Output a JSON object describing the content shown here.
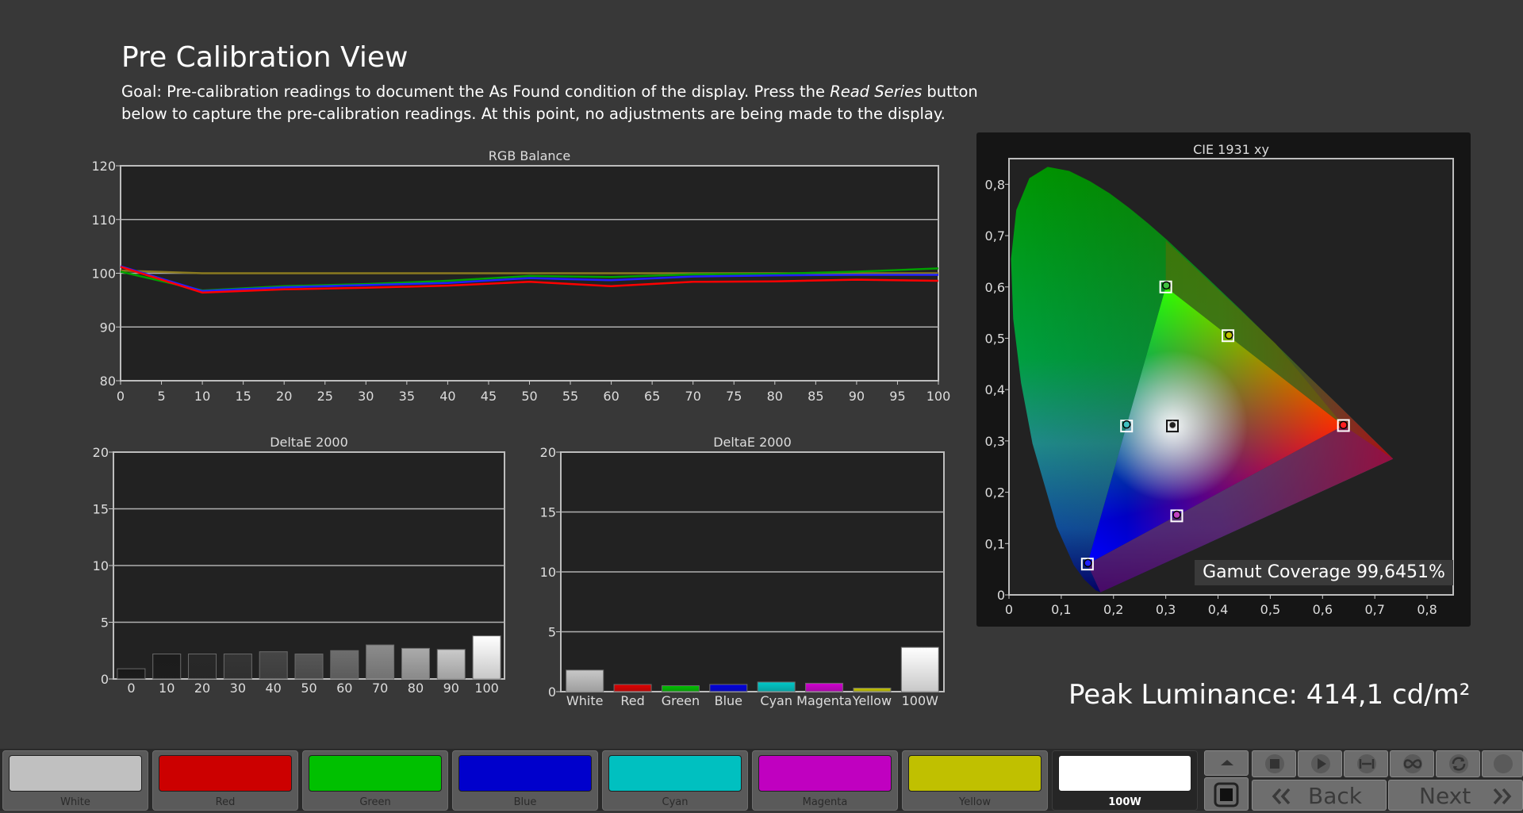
{
  "header": {
    "title": "Pre Calibration View",
    "goal_before": "Goal: Pre-calibration readings to document the As Found condition of the display. Press the ",
    "goal_emphasis": "Read Series",
    "goal_after": " button below to capture the pre-calibration readings. At this point, no adjustments are being made to the display."
  },
  "colors": {
    "background": "#383838",
    "plot_background": "#222222",
    "red_line": "#ff0000",
    "green_line": "#00a000",
    "blue_line": "#2020ff",
    "olive_line": "#8a7a20"
  },
  "chart_data": [
    {
      "id": "rgb_balance",
      "type": "line",
      "title": "RGB Balance",
      "x": [
        0,
        10,
        20,
        30,
        40,
        50,
        60,
        70,
        80,
        90,
        100
      ],
      "x_ticks": [
        0,
        5,
        10,
        15,
        20,
        25,
        30,
        35,
        40,
        45,
        50,
        55,
        60,
        65,
        70,
        75,
        80,
        85,
        90,
        95,
        100
      ],
      "xlim": [
        0,
        100
      ],
      "ylim": [
        80,
        120
      ],
      "y_ticks": [
        80,
        90,
        100,
        110,
        120
      ],
      "grid": true,
      "series": [
        {
          "color": "#ff0000",
          "values": [
            101.2,
            96.4,
            97.0,
            97.3,
            97.7,
            98.4,
            97.6,
            98.4,
            98.5,
            98.8,
            98.6
          ]
        },
        {
          "color": "#00a000",
          "values": [
            100.3,
            96.8,
            97.6,
            98.0,
            98.6,
            99.5,
            99.3,
            99.8,
            99.9,
            100.3,
            100.9
          ]
        },
        {
          "color": "#2020ff",
          "values": [
            101.3,
            96.7,
            97.4,
            97.8,
            98.2,
            99.1,
            98.7,
            99.4,
            99.6,
            99.7,
            99.7
          ]
        },
        {
          "color": "#8a7a20",
          "values": [
            100.5,
            100.0,
            100.0,
            100.0,
            100.0,
            100.0,
            100.0,
            100.0,
            100.0,
            100.0,
            100.0
          ]
        }
      ]
    },
    {
      "id": "deltae_grayscale",
      "type": "bar",
      "title": "DeltaE 2000",
      "categories": [
        "0",
        "10",
        "20",
        "30",
        "40",
        "50",
        "60",
        "70",
        "80",
        "90",
        "100"
      ],
      "values": [
        0.9,
        2.2,
        2.2,
        2.2,
        2.4,
        2.2,
        2.5,
        3.0,
        2.7,
        2.6,
        3.8
      ],
      "bar_colors": [
        "#1a1a1a",
        "#1c1c1c",
        "#282828",
        "#353535",
        "#464646",
        "#575757",
        "#6e6e6e",
        "#8c8c8c",
        "#ababab",
        "#cacaca",
        "#ffffff"
      ],
      "ylim": [
        0,
        20
      ],
      "y_ticks": [
        0,
        5,
        10,
        15,
        20
      ],
      "grid": true
    },
    {
      "id": "deltae_colors",
      "type": "bar",
      "title": "DeltaE 2000",
      "categories": [
        "White",
        "Red",
        "Green",
        "Blue",
        "Cyan",
        "Magenta",
        "Yellow",
        "100W"
      ],
      "values": [
        1.8,
        0.6,
        0.5,
        0.6,
        0.8,
        0.7,
        0.3,
        3.7
      ],
      "bar_colors": [
        "#c8c8c8",
        "#e00000",
        "#00c000",
        "#0000e0",
        "#00c8c8",
        "#d000d0",
        "#c8c800",
        "#ffffff"
      ],
      "ylim": [
        0,
        20
      ],
      "y_ticks": [
        0,
        5,
        10,
        15,
        20
      ],
      "grid": true
    },
    {
      "id": "cie_1931",
      "type": "scatter",
      "title": "CIE 1931 xy",
      "xlim": [
        0,
        0.85
      ],
      "ylim": [
        0,
        0.85
      ],
      "x_ticks": [
        "0",
        "0,1",
        "0,2",
        "0,3",
        "0,4",
        "0,5",
        "0,6",
        "0,7",
        "0,8"
      ],
      "y_ticks": [
        "0",
        "0,1",
        "0,2",
        "0,3",
        "0,4",
        "0,5",
        "0,6",
        "0,7",
        "0,8"
      ],
      "targets": [
        {
          "name": "Red",
          "x": 0.64,
          "y": 0.33
        },
        {
          "name": "Green",
          "x": 0.3,
          "y": 0.6
        },
        {
          "name": "Blue",
          "x": 0.15,
          "y": 0.06
        },
        {
          "name": "Cyan",
          "x": 0.225,
          "y": 0.329
        },
        {
          "name": "Magenta",
          "x": 0.321,
          "y": 0.154
        },
        {
          "name": "Yellow",
          "x": 0.419,
          "y": 0.505
        },
        {
          "name": "White",
          "x": 0.3127,
          "y": 0.329
        }
      ],
      "measured": [
        {
          "name": "Green",
          "x": 0.301,
          "y": 0.603,
          "color": "#40c040"
        },
        {
          "name": "Yellow",
          "x": 0.421,
          "y": 0.506,
          "color": "#c0c000"
        },
        {
          "name": "Cyan",
          "x": 0.225,
          "y": 0.332,
          "color": "#40c0c0"
        },
        {
          "name": "White",
          "x": 0.313,
          "y": 0.331,
          "color": "#202020"
        },
        {
          "name": "Magenta",
          "x": 0.321,
          "y": 0.156,
          "color": "#c040c0"
        },
        {
          "name": "Red",
          "x": 0.64,
          "y": 0.331,
          "color": "#ff2020"
        },
        {
          "name": "Blue",
          "x": 0.151,
          "y": 0.062,
          "color": "#2020ff"
        }
      ]
    }
  ],
  "gamut_coverage": "Gamut Coverage 99,6451%",
  "peak_luminance": "Peak Luminance: 414,1 cd/m²",
  "toolbar": {
    "swatches": [
      {
        "label": "White",
        "color": "#c0c0c0"
      },
      {
        "label": "Red",
        "color": "#cc0000"
      },
      {
        "label": "Green",
        "color": "#00c000"
      },
      {
        "label": "Blue",
        "color": "#0000cc"
      },
      {
        "label": "Cyan",
        "color": "#00c0c0"
      },
      {
        "label": "Magenta",
        "color": "#c000c0"
      },
      {
        "label": "Yellow",
        "color": "#c0c000"
      },
      {
        "label": "100W",
        "color": "#ffffff"
      }
    ],
    "back_label": "Back",
    "next_label": "Next"
  }
}
